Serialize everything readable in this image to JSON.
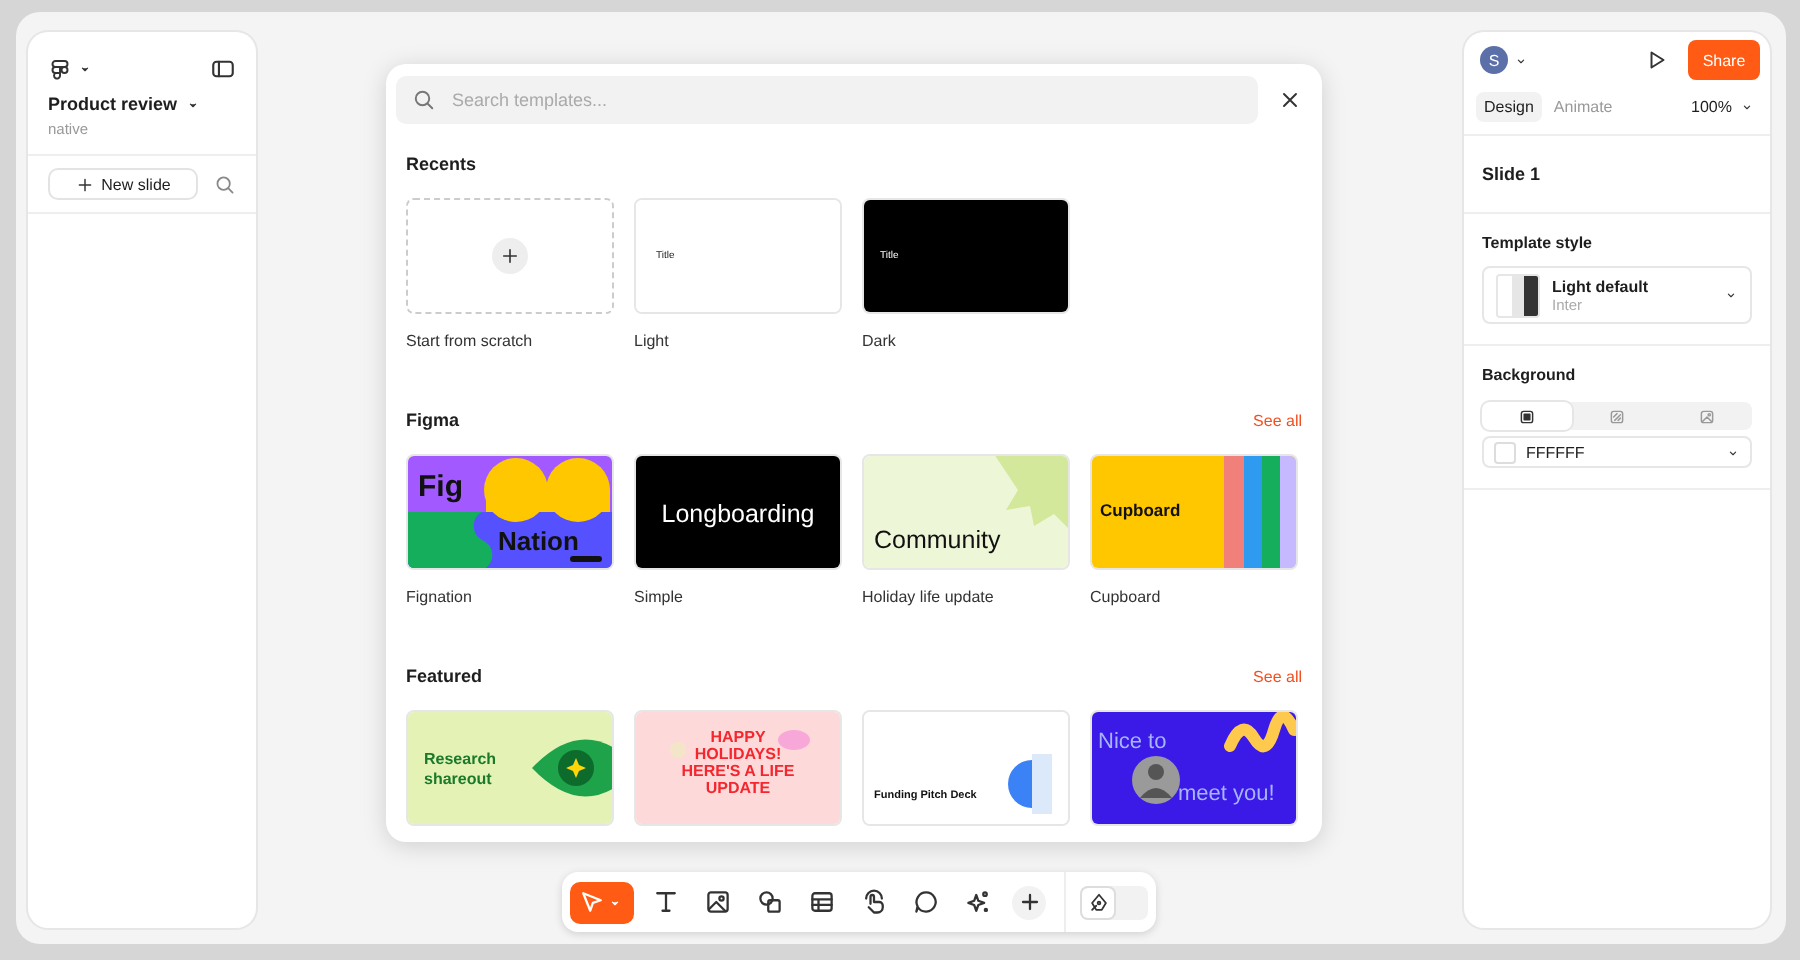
{
  "left_panel": {
    "file_name": "Product review",
    "file_subtitle": "native",
    "new_slide_button": "New slide"
  },
  "template_modal": {
    "search": {
      "placeholder": "Search templates..."
    },
    "sections": [
      {
        "title": "Recents",
        "items": [
          {
            "kind": "scratch",
            "label": "Start from scratch"
          },
          {
            "kind": "light",
            "label": "Light",
            "preview": [
              "Title"
            ]
          },
          {
            "kind": "dark",
            "label": "Dark",
            "preview": [
              "Title"
            ]
          }
        ]
      },
      {
        "title": "Figma",
        "see_all": "See all",
        "items": [
          {
            "kind": "fignation",
            "label": "Fignation",
            "preview": [
              "Fig",
              "Nation"
            ]
          },
          {
            "kind": "simple",
            "label": "Simple",
            "preview": [
              "Longboarding"
            ]
          },
          {
            "kind": "community",
            "label": "Holiday life update",
            "preview": [
              "Community"
            ]
          },
          {
            "kind": "cupboard",
            "label": "Cupboard",
            "preview": [
              "Cupboard"
            ]
          }
        ]
      },
      {
        "title": "Featured",
        "see_all": "See all",
        "items": [
          {
            "kind": "research",
            "preview": [
              "Research",
              "shareout"
            ]
          },
          {
            "kind": "holiday",
            "preview": [
              "HAPPY",
              "HOLIDAYS!",
              "HERE'S A LIFE",
              "UPDATE"
            ]
          },
          {
            "kind": "pitch",
            "preview": [
              "Funding Pitch Deck"
            ]
          },
          {
            "kind": "nice",
            "preview": [
              "Nice to",
              "meet you!"
            ]
          }
        ]
      }
    ]
  },
  "right_panel": {
    "avatar": "S",
    "share_button": "Share",
    "tabs": [
      {
        "label": "Design",
        "selected": true
      },
      {
        "label": "Animate",
        "selected": false
      }
    ],
    "zoom": "100%",
    "slide_title": "Slide 1",
    "template_style": {
      "title": "Template style",
      "name": "Light default",
      "font": "Inter"
    },
    "background": {
      "title": "Background",
      "fill_types": [
        {
          "kind": "solid",
          "selected": true
        },
        {
          "kind": "pattern",
          "selected": false
        },
        {
          "kind": "image",
          "selected": false
        }
      ],
      "color": "FFFFFF"
    }
  },
  "toolbar": {
    "tools": [
      {
        "kind": "move",
        "selected": true
      },
      {
        "kind": "text",
        "selected": false
      },
      {
        "kind": "image",
        "selected": false
      },
      {
        "kind": "shapes",
        "selected": false
      },
      {
        "kind": "table",
        "selected": false
      },
      {
        "kind": "interaction",
        "selected": false
      },
      {
        "kind": "comment",
        "selected": false
      },
      {
        "kind": "ai",
        "selected": false
      },
      {
        "kind": "plus",
        "selected": false
      }
    ],
    "draw_mode": false
  }
}
